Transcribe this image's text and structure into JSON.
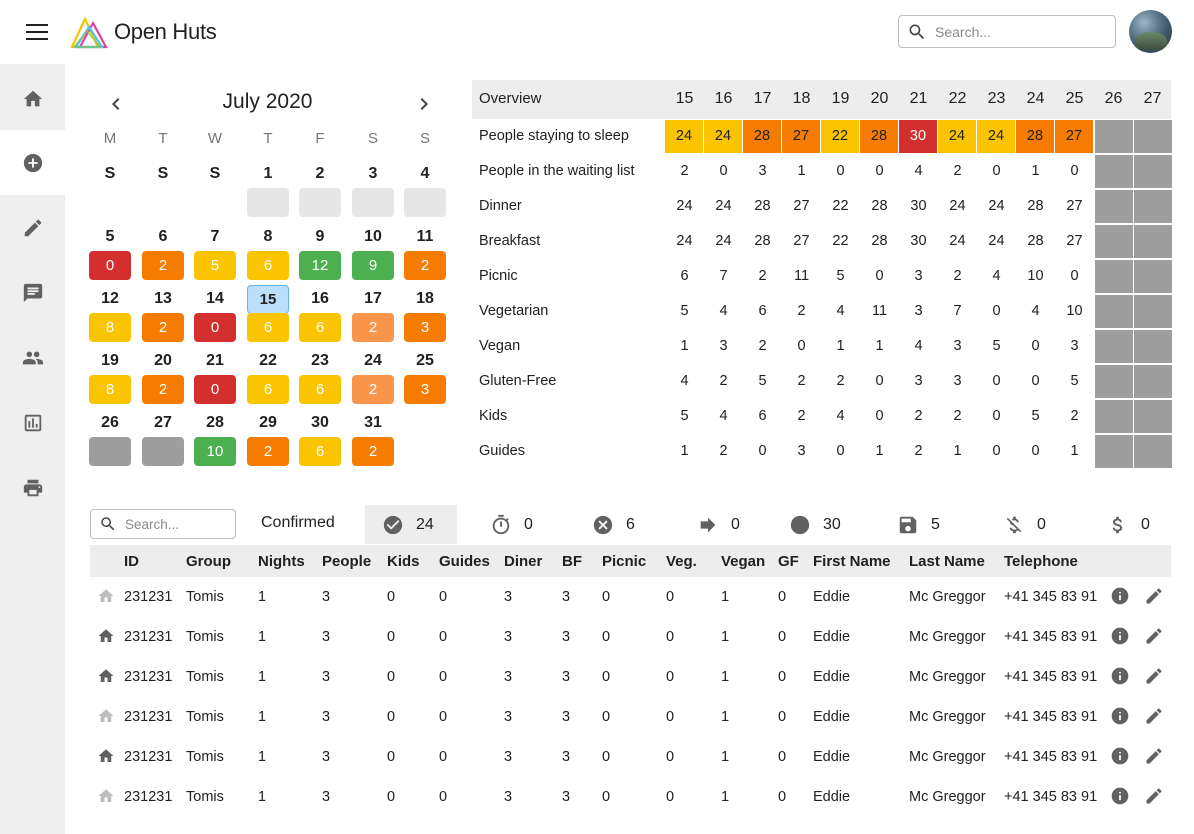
{
  "app": {
    "title": "Open Huts"
  },
  "top_search": {
    "placeholder": "Search..."
  },
  "sidebar": [
    {
      "icon": "home-icon"
    },
    {
      "icon": "add-circle-icon"
    },
    {
      "icon": "pencil-icon"
    },
    {
      "icon": "chat-icon"
    },
    {
      "icon": "people-icon"
    },
    {
      "icon": "chart-icon"
    },
    {
      "icon": "printer-icon"
    }
  ],
  "calendar": {
    "title": "July 2020",
    "weekdays": [
      "M",
      "T",
      "W",
      "T",
      "F",
      "S",
      "S"
    ],
    "weeks": [
      [
        {
          "d": "S"
        },
        {
          "d": "S"
        },
        {
          "d": "S"
        },
        {
          "d": "1",
          "c": "empty"
        },
        {
          "d": "2",
          "c": "empty"
        },
        {
          "d": "3",
          "c": "empty"
        },
        {
          "d": "4",
          "c": "empty"
        }
      ],
      [
        {
          "d": "5",
          "v": "0",
          "c": "red"
        },
        {
          "d": "6",
          "v": "2",
          "c": "orange"
        },
        {
          "d": "7",
          "v": "5",
          "c": "yellow"
        },
        {
          "d": "8",
          "v": "6",
          "c": "yellow"
        },
        {
          "d": "9",
          "v": "12",
          "c": "green"
        },
        {
          "d": "10",
          "v": "9",
          "c": "green"
        },
        {
          "d": "11",
          "v": "2",
          "c": "orange"
        }
      ],
      [
        {
          "d": "12",
          "v": "8",
          "c": "yellow"
        },
        {
          "d": "13",
          "v": "2",
          "c": "orange"
        },
        {
          "d": "14",
          "v": "0",
          "c": "red"
        },
        {
          "d": "15",
          "v": "6",
          "c": "yellow",
          "today": true
        },
        {
          "d": "16",
          "v": "6",
          "c": "yellow"
        },
        {
          "d": "17",
          "v": "2",
          "c": "lorange"
        },
        {
          "d": "18",
          "v": "3",
          "c": "orange"
        }
      ],
      [
        {
          "d": "19",
          "v": "8",
          "c": "yellow"
        },
        {
          "d": "20",
          "v": "2",
          "c": "orange"
        },
        {
          "d": "21",
          "v": "0",
          "c": "red"
        },
        {
          "d": "22",
          "v": "6",
          "c": "yellow"
        },
        {
          "d": "23",
          "v": "6",
          "c": "yellow"
        },
        {
          "d": "24",
          "v": "2",
          "c": "lorange"
        },
        {
          "d": "25",
          "v": "3",
          "c": "orange"
        }
      ],
      [
        {
          "d": "26",
          "v": "",
          "c": "grey"
        },
        {
          "d": "27",
          "v": "",
          "c": "grey"
        },
        {
          "d": "28",
          "v": "10",
          "c": "green"
        },
        {
          "d": "29",
          "v": "2",
          "c": "orange"
        },
        {
          "d": "30",
          "v": "6",
          "c": "yellow"
        },
        {
          "d": "31",
          "v": "2",
          "c": "orange"
        }
      ]
    ]
  },
  "overview": {
    "label": "Overview",
    "days": [
      "15",
      "16",
      "17",
      "18",
      "19",
      "20",
      "21",
      "22",
      "23",
      "24",
      "25",
      "26",
      "27"
    ],
    "sleep_colors": [
      "yellow",
      "yellow",
      "orange",
      "orange",
      "yellow",
      "orange",
      "red",
      "yellow",
      "yellow",
      "orange",
      "orange"
    ],
    "rows": [
      {
        "label": "People staying to sleep",
        "values": [
          "24",
          "24",
          "28",
          "27",
          "22",
          "28",
          "30",
          "24",
          "24",
          "28",
          "27"
        ]
      },
      {
        "label": "People in the waiting list",
        "values": [
          "2",
          "0",
          "3",
          "1",
          "0",
          "0",
          "4",
          "2",
          "0",
          "1",
          "0"
        ]
      },
      {
        "label": "Dinner",
        "values": [
          "24",
          "24",
          "28",
          "27",
          "22",
          "28",
          "30",
          "24",
          "24",
          "28",
          "27"
        ]
      },
      {
        "label": "Breakfast",
        "values": [
          "24",
          "24",
          "28",
          "27",
          "22",
          "28",
          "30",
          "24",
          "24",
          "28",
          "27"
        ]
      },
      {
        "label": "Picnic",
        "values": [
          "6",
          "7",
          "2",
          "11",
          "5",
          "0",
          "3",
          "2",
          "4",
          "10",
          "0"
        ]
      },
      {
        "label": "Vegetarian",
        "values": [
          "5",
          "4",
          "6",
          "2",
          "4",
          "11",
          "3",
          "7",
          "0",
          "4",
          "10"
        ]
      },
      {
        "label": "Vegan",
        "values": [
          "1",
          "3",
          "2",
          "0",
          "1",
          "1",
          "4",
          "3",
          "5",
          "0",
          "3"
        ]
      },
      {
        "label": "Gluten-Free",
        "values": [
          "4",
          "2",
          "5",
          "2",
          "2",
          "0",
          "3",
          "3",
          "0",
          "0",
          "5"
        ]
      },
      {
        "label": "Kids",
        "values": [
          "5",
          "4",
          "6",
          "2",
          "4",
          "0",
          "2",
          "2",
          "0",
          "5",
          "2"
        ]
      },
      {
        "label": "Guides",
        "values": [
          "1",
          "2",
          "0",
          "3",
          "0",
          "1",
          "2",
          "1",
          "0",
          "0",
          "1"
        ]
      }
    ]
  },
  "bookings": {
    "search_placeholder": "Search...",
    "confirmed_label": "Confirmed",
    "stats": [
      {
        "icon": "check-circle-icon",
        "value": "24"
      },
      {
        "icon": "timer-icon",
        "value": "0"
      },
      {
        "icon": "cancel-circle-icon",
        "value": "6"
      },
      {
        "icon": "arrow-right-icon",
        "value": "0"
      },
      {
        "icon": "circle-icon",
        "value": "30"
      },
      {
        "icon": "save-icon",
        "value": "5"
      },
      {
        "icon": "money-off-icon",
        "value": "0"
      },
      {
        "icon": "dollar-icon",
        "value": "0"
      }
    ],
    "columns": [
      "ID",
      "Group",
      "Nights",
      "People",
      "Kids",
      "Guides",
      "Diner",
      "BF",
      "Picnic",
      "Veg.",
      "Vegan",
      "GF",
      "First Name",
      "Last Name",
      "Telephone"
    ],
    "rows": [
      {
        "house": "light",
        "cells": [
          "231231",
          "Tomis",
          "1",
          "3",
          "0",
          "0",
          "3",
          "3",
          "0",
          "0",
          "1",
          "0",
          "Eddie",
          "Mc Greggor",
          "+41 345 83 91"
        ]
      },
      {
        "house": "dark",
        "cells": [
          "231231",
          "Tomis",
          "1",
          "3",
          "0",
          "0",
          "3",
          "3",
          "0",
          "0",
          "1",
          "0",
          "Eddie",
          "Mc Greggor",
          "+41 345 83 91"
        ]
      },
      {
        "house": "dark",
        "cells": [
          "231231",
          "Tomis",
          "1",
          "3",
          "0",
          "0",
          "3",
          "3",
          "0",
          "0",
          "1",
          "0",
          "Eddie",
          "Mc Greggor",
          "+41 345 83 91"
        ]
      },
      {
        "house": "light",
        "cells": [
          "231231",
          "Tomis",
          "1",
          "3",
          "0",
          "0",
          "3",
          "3",
          "0",
          "0",
          "1",
          "0",
          "Eddie",
          "Mc Greggor",
          "+41 345 83 91"
        ]
      },
      {
        "house": "dark",
        "cells": [
          "231231",
          "Tomis",
          "1",
          "3",
          "0",
          "0",
          "3",
          "3",
          "0",
          "0",
          "1",
          "0",
          "Eddie",
          "Mc Greggor",
          "+41 345 83 91"
        ]
      },
      {
        "house": "light",
        "cells": [
          "231231",
          "Tomis",
          "1",
          "3",
          "0",
          "0",
          "3",
          "3",
          "0",
          "0",
          "1",
          "0",
          "Eddie",
          "Mc Greggor",
          "+41 345 83 91"
        ]
      }
    ]
  },
  "colors": {
    "red": "#d32f2f",
    "orange": "#f57c00",
    "yellow": "#fbc400",
    "green": "#4caf50",
    "light_orange": "#f9964b",
    "grey": "#9e9e9e"
  }
}
